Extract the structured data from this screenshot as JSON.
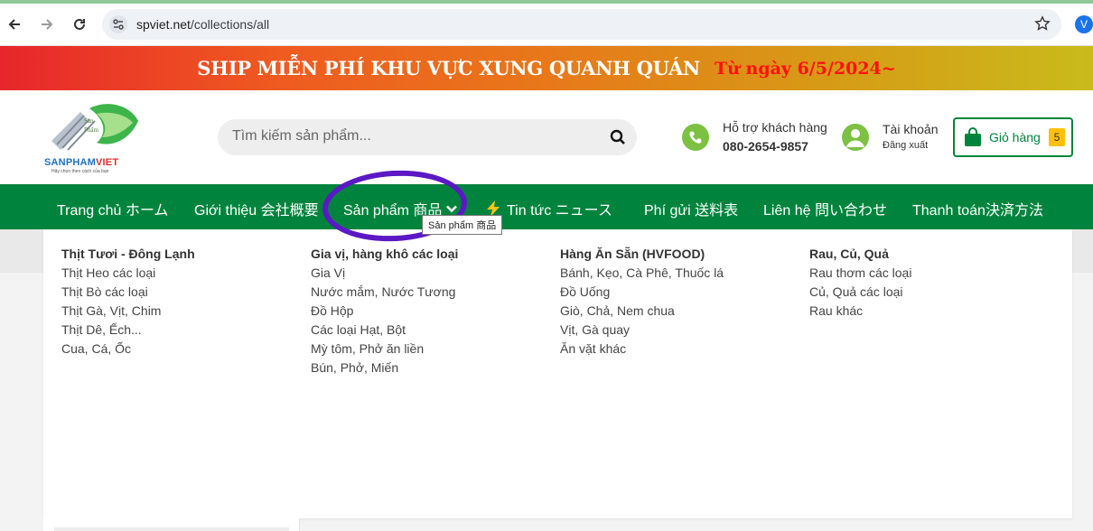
{
  "browser": {
    "url_domain": "spviet.net",
    "url_path": "/collections/all",
    "profile_letter": "V",
    "icons": [
      "back-arrow-icon",
      "forward-arrow-icon",
      "reload-icon",
      "site-settings-icon",
      "bookmark-star-icon"
    ]
  },
  "promo": {
    "main_text": "SHIP MIỄN PHÍ KHU VỰC XUNG QUANH QUÁN",
    "date_text": "Từ ngày 6/5/2024~"
  },
  "header": {
    "logo_text_a": "SANPHAM",
    "logo_text_b": "VIET",
    "logo_tagline": "Hãy chọn theo cách của bạn",
    "search_placeholder": "Tìm kiếm sản phẩm...",
    "support_label": "Hỗ trợ khách hàng",
    "support_phone": "080-2654-9857",
    "account_label": "Tài khoản",
    "account_logout": "Đăng xuất",
    "cart_label": "Giỏ hàng",
    "cart_count": "5"
  },
  "nav": {
    "items": [
      {
        "label": "Trang chủ ホーム"
      },
      {
        "label": "Giới thiệu 会社概要"
      },
      {
        "label": "Sản phẩm 商品"
      },
      {
        "label": "Tin tức ニュース"
      },
      {
        "label": "Phí gửi 送料表"
      },
      {
        "label": "Liên hệ 問い合わせ"
      },
      {
        "label": "Thanh toán決済方法"
      }
    ],
    "tooltip": "Sản phẩm 商品"
  },
  "mega_menu": {
    "columns": [
      {
        "heading": "Thịt Tươi - Đông Lạnh",
        "links": [
          "Thịt Heo các loại",
          "Thịt Bò các loại",
          "Thịt Gà, Vịt, Chim",
          "Thịt Dê, Ếch...",
          "Cua, Cá, Ốc"
        ]
      },
      {
        "heading": "Gia vị, hàng khô các loại",
        "links": [
          "Gia Vị",
          "Nước mắm, Nước Tương",
          "Đồ Hộp",
          "Các loại Hạt, Bột",
          "Mỳ tôm, Phở ăn liền",
          "Bún, Phở, Miến"
        ]
      },
      {
        "heading": "Hàng Ăn Sẵn (HVFOOD)",
        "links": [
          "Bánh, Kẹo, Cà Phê, Thuốc lá",
          "Đồ Uống",
          "Giò, Chả, Nem chua",
          "Vịt, Gà quay",
          "Ăn vặt khác"
        ]
      },
      {
        "heading": "Rau, Củ, Quả",
        "links": [
          "Rau thơm các loại",
          "Củ, Quả các loại",
          "Rau khác"
        ]
      }
    ]
  },
  "colors": {
    "nav_green": "#00843d",
    "icon_green": "#7cc142",
    "annotation_purple": "#5b18c4",
    "cart_badge": "#ffc107"
  }
}
